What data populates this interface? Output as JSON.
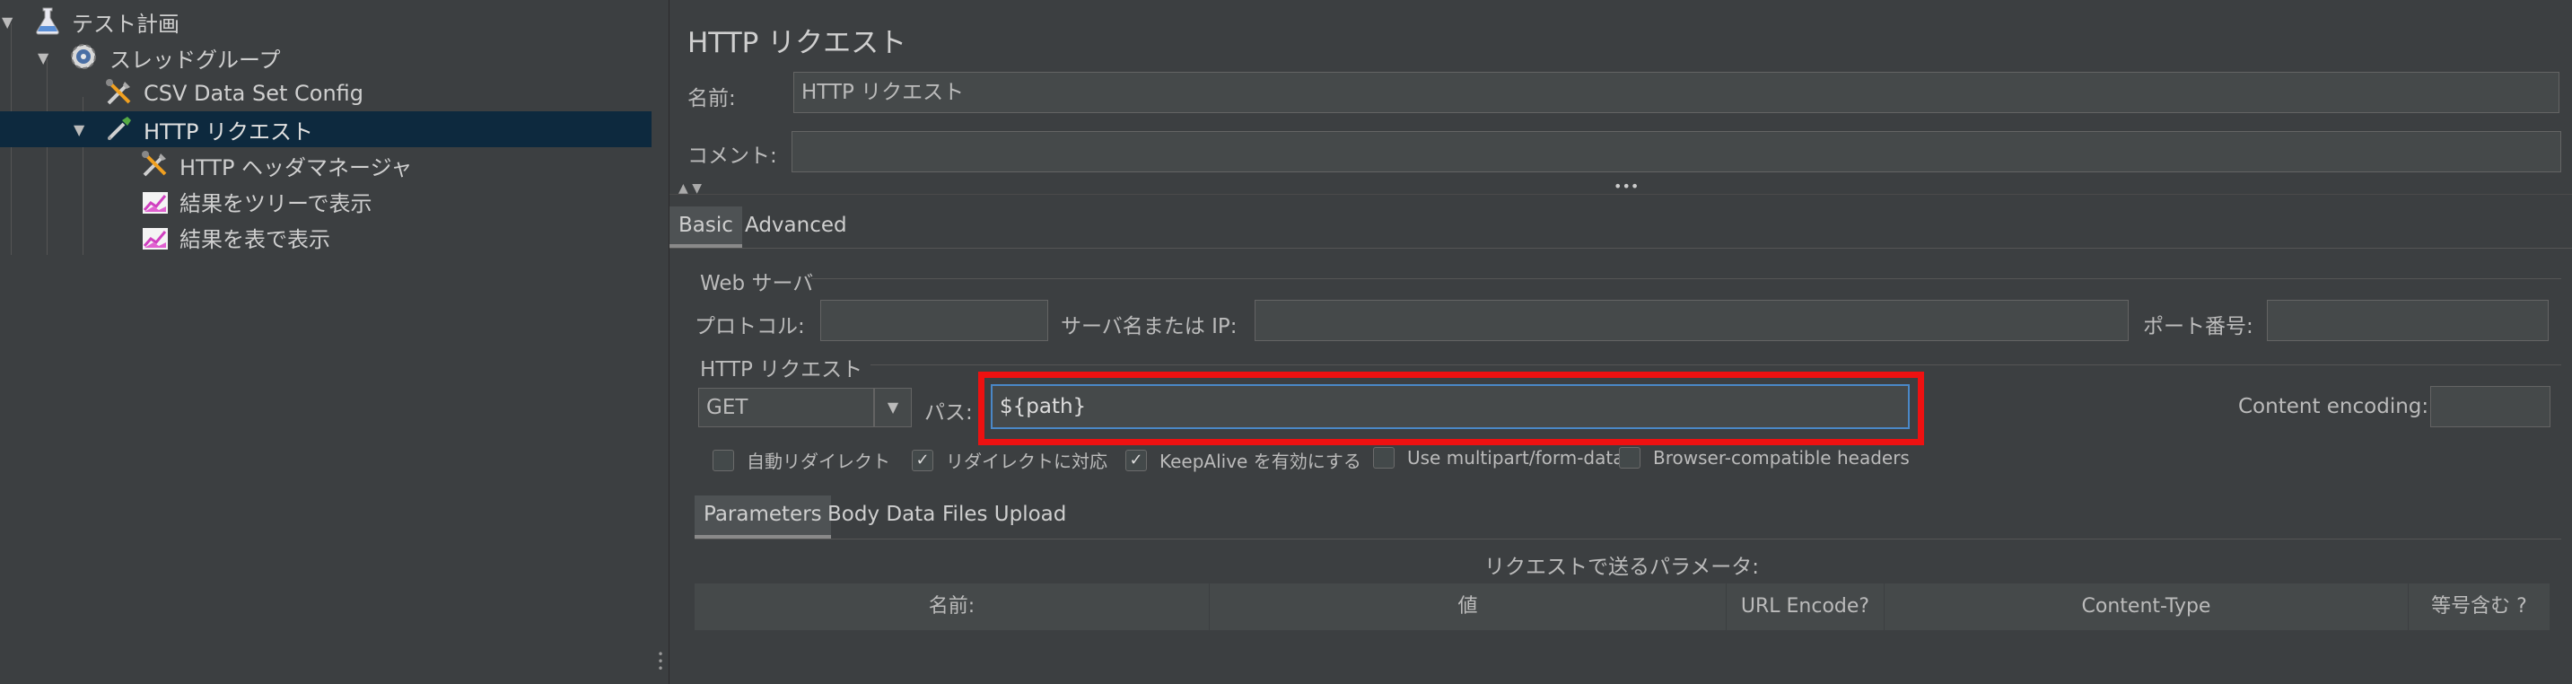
{
  "tree": {
    "items": [
      {
        "label": "テスト計画",
        "icon": "flask-icon",
        "expanded": true
      },
      {
        "label": "スレッドグループ",
        "icon": "gear-icon",
        "expanded": true
      },
      {
        "label": "CSV Data Set Config",
        "icon": "tools-icon"
      },
      {
        "label": "HTTP リクエスト",
        "icon": "pipette-icon",
        "expanded": true,
        "selected": true
      },
      {
        "label": "HTTP ヘッダマネージャ",
        "icon": "tools-icon"
      },
      {
        "label": "結果をツリーで表示",
        "icon": "graph-icon"
      },
      {
        "label": "結果を表で表示",
        "icon": "graph-icon"
      }
    ]
  },
  "panel": {
    "title": "HTTP リクエスト",
    "name_label": "名前:",
    "name_value": "HTTP リクエスト",
    "comment_label": "コメント:",
    "comment_value": "",
    "tabs": [
      "Basic",
      "Advanced"
    ],
    "web_server_section": "Web サーバ",
    "protocol_label": "プロトコル:",
    "protocol_value": "",
    "server_label": "サーバ名または IP:",
    "server_value": "",
    "port_label": "ポート番号:",
    "port_value": "",
    "http_request_section": "HTTP リクエスト",
    "method": "GET",
    "path_label": "パス:",
    "path_value": "${path}",
    "encoding_label": "Content encoding:",
    "encoding_value": "",
    "checkboxes": [
      {
        "label": "自動リダイレクト",
        "checked": false
      },
      {
        "label": "リダイレクトに対応",
        "checked": true
      },
      {
        "label": "KeepAlive を有効にする",
        "checked": true
      },
      {
        "label": "Use multipart/form-data",
        "checked": false
      },
      {
        "label": "Browser-compatible headers",
        "checked": false
      }
    ],
    "subtabs": [
      "Parameters",
      "Body Data",
      "Files Upload"
    ],
    "params_caption": "リクエストで送るパラメータ:",
    "columns": [
      "名前:",
      "値",
      "URL Encode?",
      "Content-Type",
      "等号含む ?"
    ]
  },
  "colors": {
    "highlight": "#ee1111",
    "selected_row": "#0d293e",
    "focus_border": "#4a88c7"
  }
}
